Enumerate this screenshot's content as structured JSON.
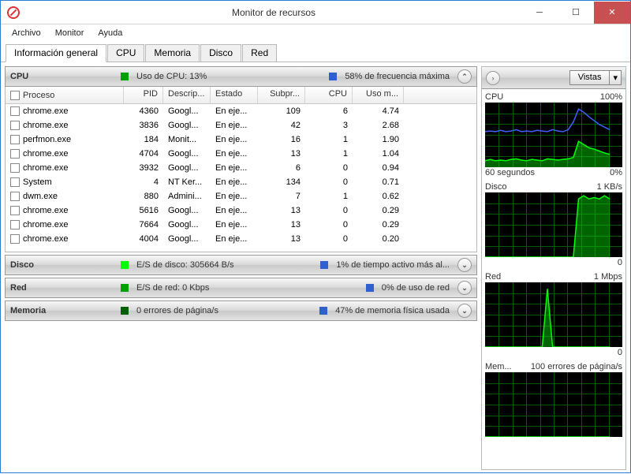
{
  "window": {
    "title": "Monitor de recursos"
  },
  "menu": [
    "Archivo",
    "Monitor",
    "Ayuda"
  ],
  "tabs": [
    "Información general",
    "CPU",
    "Memoria",
    "Disco",
    "Red"
  ],
  "active_tab": 0,
  "cpu_panel": {
    "name": "CPU",
    "stat1": "Uso de CPU: 13%",
    "stat2": "58% de frecuencia máxima",
    "color1": "#00a000",
    "color2": "#3060d0"
  },
  "disk_panel": {
    "name": "Disco",
    "stat1": "E/S de disco: 305664 B/s",
    "stat2": "1% de tiempo activo más al...",
    "color1": "#00ff00",
    "color2": "#3060d0"
  },
  "net_panel": {
    "name": "Red",
    "stat1": "E/S de red: 0 Kbps",
    "stat2": "0% de uso de red",
    "color1": "#00a000",
    "color2": "#3060d0"
  },
  "mem_panel": {
    "name": "Memoria",
    "stat1": "0 errores de página/s",
    "stat2": "47% de memoria física usada",
    "color1": "#006000",
    "color2": "#3060d0"
  },
  "columns": [
    "Proceso",
    "PID",
    "Descrip...",
    "Estado",
    "Subpr...",
    "CPU",
    "Uso m..."
  ],
  "rows": [
    {
      "p": "chrome.exe",
      "pid": "4360",
      "d": "Googl...",
      "e": "En eje...",
      "s": "109",
      "c": "6",
      "u": "4.74"
    },
    {
      "p": "chrome.exe",
      "pid": "3836",
      "d": "Googl...",
      "e": "En eje...",
      "s": "42",
      "c": "3",
      "u": "2.68"
    },
    {
      "p": "perfmon.exe",
      "pid": "184",
      "d": "Monit...",
      "e": "En eje...",
      "s": "16",
      "c": "1",
      "u": "1.90"
    },
    {
      "p": "chrome.exe",
      "pid": "4704",
      "d": "Googl...",
      "e": "En eje...",
      "s": "13",
      "c": "1",
      "u": "1.04"
    },
    {
      "p": "chrome.exe",
      "pid": "3932",
      "d": "Googl...",
      "e": "En eje...",
      "s": "6",
      "c": "0",
      "u": "0.94"
    },
    {
      "p": "System",
      "pid": "4",
      "d": "NT Ker...",
      "e": "En eje...",
      "s": "134",
      "c": "0",
      "u": "0.71"
    },
    {
      "p": "dwm.exe",
      "pid": "880",
      "d": "Admini...",
      "e": "En eje...",
      "s": "7",
      "c": "1",
      "u": "0.62"
    },
    {
      "p": "chrome.exe",
      "pid": "5616",
      "d": "Googl...",
      "e": "En eje...",
      "s": "13",
      "c": "0",
      "u": "0.29"
    },
    {
      "p": "chrome.exe",
      "pid": "7664",
      "d": "Googl...",
      "e": "En eje...",
      "s": "13",
      "c": "0",
      "u": "0.29"
    },
    {
      "p": "chrome.exe",
      "pid": "4004",
      "d": "Googl...",
      "e": "En eje...",
      "s": "13",
      "c": "0",
      "u": "0.20"
    }
  ],
  "right": {
    "vistas": "Vistas",
    "charts": [
      {
        "name": "CPU",
        "top_right": "100%",
        "bot_left": "60 segundos",
        "bot_right": "0%",
        "type": "cpu"
      },
      {
        "name": "Disco",
        "top_right": "1 KB/s",
        "bot_left": "",
        "bot_right": "0",
        "type": "disk"
      },
      {
        "name": "Red",
        "top_right": "1 Mbps",
        "bot_left": "",
        "bot_right": "0",
        "type": "net"
      },
      {
        "name": "Mem...",
        "top_right": "100 errores de página/s",
        "bot_left": "",
        "bot_right": "",
        "type": "mem"
      }
    ]
  },
  "chart_data": [
    {
      "type": "line",
      "title": "CPU",
      "ylim": [
        0,
        100
      ],
      "series": [
        {
          "name": "usage",
          "color": "#00ff00",
          "values": [
            10,
            12,
            10,
            11,
            10,
            12,
            13,
            11,
            10,
            12,
            11,
            10,
            13,
            12,
            11,
            12,
            13,
            15,
            40,
            35,
            30,
            28,
            25,
            22,
            20
          ]
        },
        {
          "name": "freq",
          "color": "#4060ff",
          "values": [
            55,
            56,
            55,
            57,
            55,
            56,
            58,
            55,
            56,
            55,
            57,
            56,
            55,
            58,
            56,
            55,
            58,
            70,
            90,
            85,
            78,
            72,
            66,
            62,
            58
          ]
        }
      ]
    },
    {
      "type": "line",
      "title": "Disco",
      "ylim": [
        0,
        1
      ],
      "series": [
        {
          "name": "io",
          "color": "#00ff00",
          "values": [
            0,
            0,
            0,
            0,
            0,
            0,
            0,
            0,
            0,
            0,
            0,
            0,
            0,
            0,
            0,
            0,
            0,
            0,
            0.9,
            0.95,
            0.9,
            0.92,
            0.9,
            0.95,
            0.9
          ]
        }
      ]
    },
    {
      "type": "line",
      "title": "Red",
      "ylim": [
        0,
        1
      ],
      "series": [
        {
          "name": "net",
          "color": "#00ff00",
          "values": [
            0,
            0,
            0,
            0,
            0,
            0,
            0,
            0,
            0,
            0,
            0,
            0,
            0.9,
            0,
            0,
            0,
            0,
            0,
            0,
            0,
            0,
            0,
            0,
            0,
            0
          ]
        }
      ]
    },
    {
      "type": "line",
      "title": "Memoria",
      "ylim": [
        0,
        100
      ],
      "series": [
        {
          "name": "faults",
          "color": "#00ff00",
          "values": [
            0,
            0,
            0,
            0,
            0,
            0,
            0,
            0,
            0,
            0,
            0,
            0,
            0,
            0,
            0,
            0,
            0,
            0,
            0,
            0,
            0,
            0,
            0,
            0,
            0
          ]
        }
      ]
    }
  ]
}
